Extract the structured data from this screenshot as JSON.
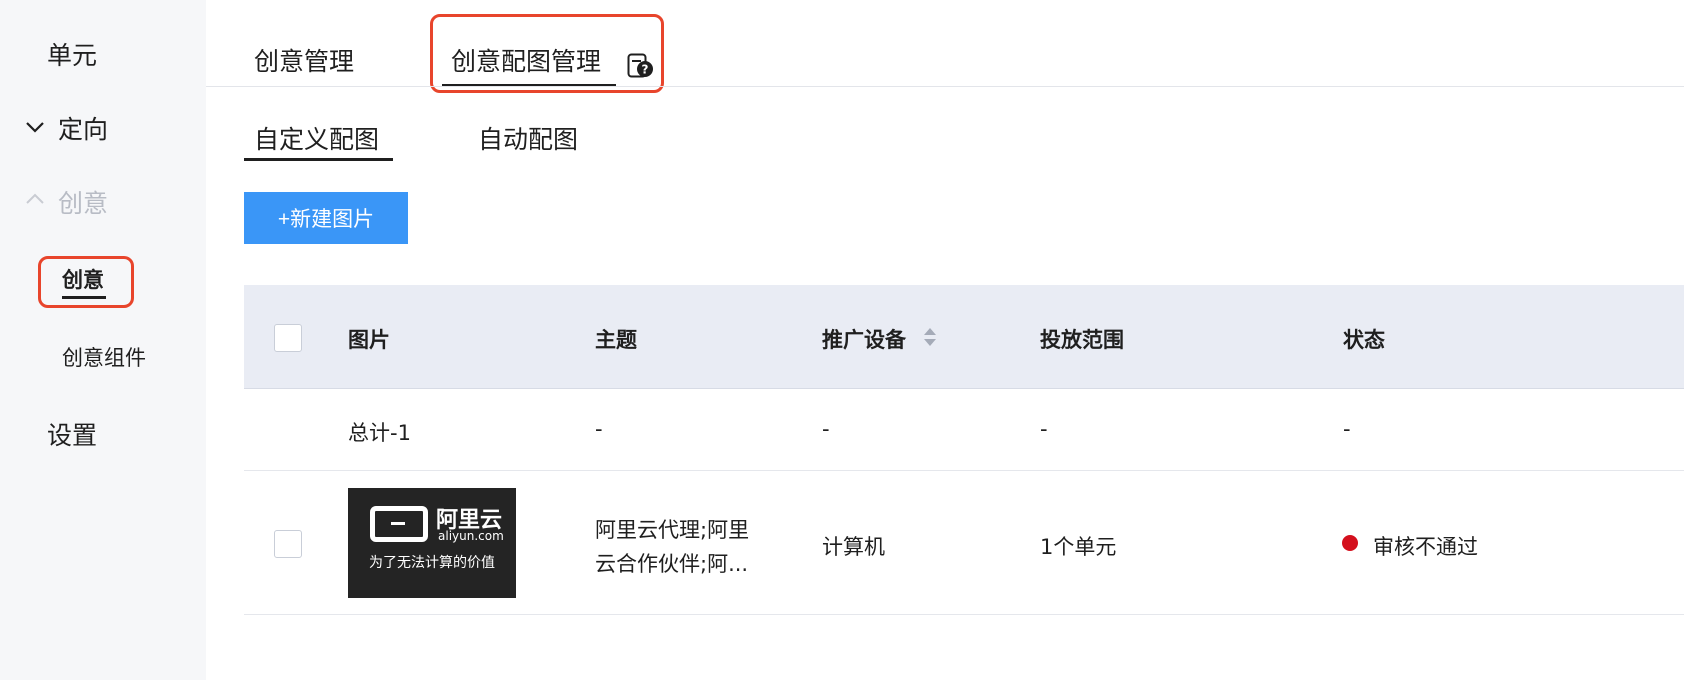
{
  "sidebar": {
    "items": [
      {
        "label": "单元"
      },
      {
        "label": "定向"
      },
      {
        "label": "创意"
      },
      {
        "label": "设置"
      }
    ],
    "sub_items": [
      {
        "label": "创意"
      },
      {
        "label": "创意组件"
      }
    ]
  },
  "tabs": {
    "top": [
      {
        "label": "创意管理"
      },
      {
        "label": "创意配图管理"
      }
    ],
    "sub": [
      {
        "label": "自定义配图"
      },
      {
        "label": "自动配图"
      }
    ]
  },
  "toolbar": {
    "new_image_label": "+新建图片"
  },
  "table": {
    "columns": [
      "图片",
      "主题",
      "推广设备",
      "投放范围",
      "状态"
    ],
    "summary_row": {
      "label": "总计-1",
      "theme": "-",
      "device": "-",
      "range": "-",
      "status": "-"
    },
    "rows": [
      {
        "image": {
          "brand": "阿里云",
          "domain": "aliyun.com",
          "slogan": "为了无法计算的价值"
        },
        "theme_line1": "阿里云代理;阿里",
        "theme_line2": "云合作伙伴;阿...",
        "device": "计算机",
        "range": "1个单元",
        "status": "审核不通过",
        "status_color": "#d4101d"
      }
    ]
  },
  "colors": {
    "accent": "#3a96f7",
    "highlight_box": "#e8452c"
  }
}
